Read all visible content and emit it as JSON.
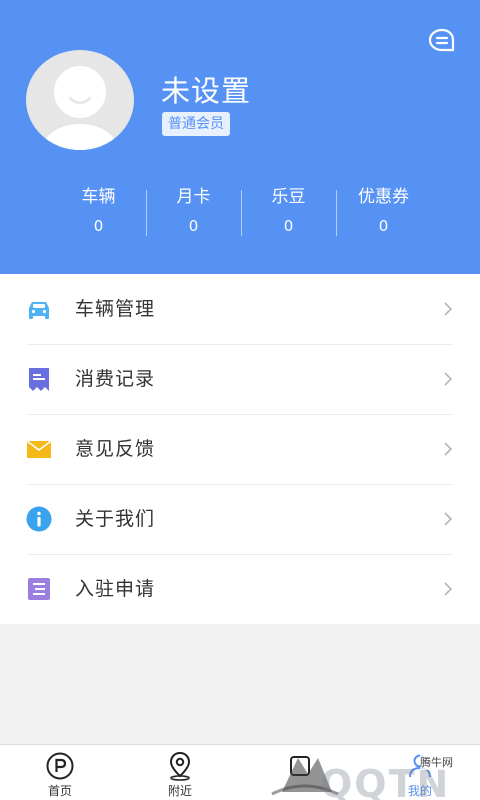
{
  "header": {
    "username": "未设置",
    "member_badge": "普通会员",
    "stats": [
      {
        "label": "车辆",
        "value": "0"
      },
      {
        "label": "月卡",
        "value": "0"
      },
      {
        "label": "乐豆",
        "value": "0"
      },
      {
        "label": "优惠券",
        "value": "0"
      }
    ],
    "accent_color": "#5592f4"
  },
  "menu": [
    {
      "label": "车辆管理",
      "icon": "car-icon",
      "color": "#4fb2f5"
    },
    {
      "label": "消费记录",
      "icon": "receipt-icon",
      "color": "#6a6fe0"
    },
    {
      "label": "意见反馈",
      "icon": "envelope-icon",
      "color": "#f5b81b"
    },
    {
      "label": "关于我们",
      "icon": "info-icon",
      "color": "#3aa3f0"
    },
    {
      "label": "入驻申请",
      "icon": "document-icon",
      "color": "#9a7fe0"
    }
  ],
  "tabbar": {
    "tabs": [
      {
        "label": "首页",
        "icon": "parking-icon"
      },
      {
        "label": "附近",
        "icon": "location-pin-icon"
      },
      {
        "label": "",
        "icon": "tab-icon"
      },
      {
        "label": "我的",
        "icon": "user-icon"
      }
    ],
    "active_index": 3
  },
  "watermark": {
    "text": "QQTN",
    "cn": "腾牛网"
  }
}
